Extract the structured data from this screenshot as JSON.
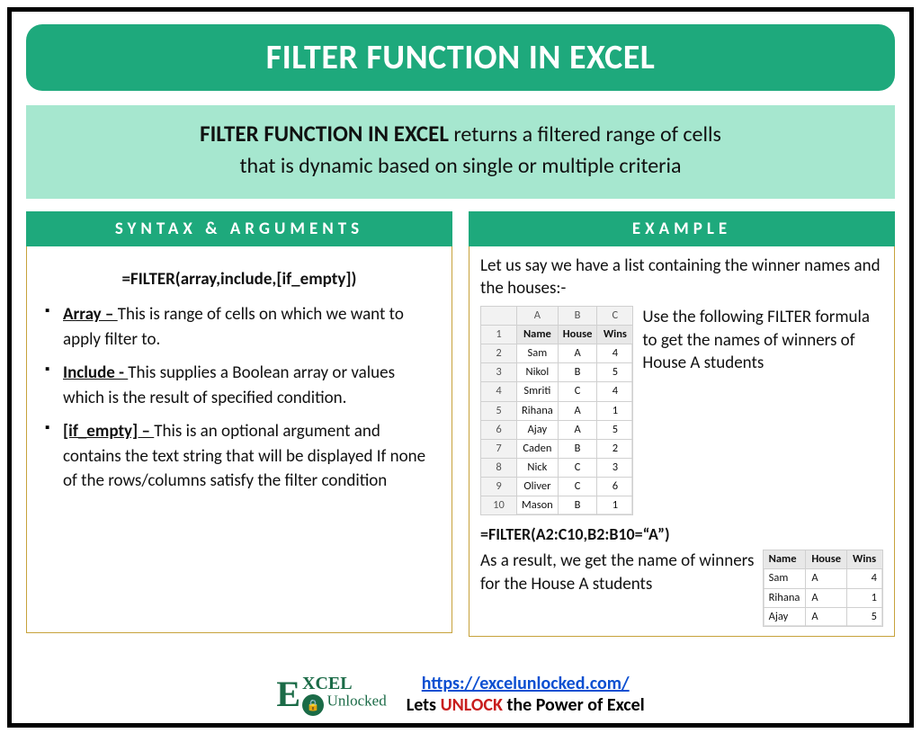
{
  "title": "FILTER FUNCTION IN EXCEL",
  "description": {
    "strong": "FILTER FUNCTION IN EXCEL",
    "rest1": " returns a filtered range of cells",
    "rest2": "that is dynamic based on single or multiple criteria"
  },
  "left": {
    "header": "SYNTAX & ARGUMENTS",
    "formula": "=FILTER(array,include,[if_empty])",
    "args": [
      {
        "name": "Array – ",
        "text": "This is range of cells on which we want to apply filter to."
      },
      {
        "name": "Include -  ",
        "text": "This supplies a Boolean array or values which is the result of specified condition."
      },
      {
        "name": "[if_empty] – ",
        "text": "This is an optional argument and contains the text string that will be displayed If none of the rows/columns satisfy the filter condition"
      }
    ]
  },
  "right": {
    "header": "EXAMPLE",
    "intro": "Let us say we have a list containing the winner names and the houses:-",
    "side_text": "Use the following FILTER formula to get the names of winners of House A students",
    "sheet": {
      "cols": [
        "A",
        "B",
        "C"
      ],
      "headers": [
        "Name",
        "House",
        "Wins"
      ],
      "rows": [
        {
          "n": "2",
          "cells": [
            "Sam",
            "A",
            "4"
          ]
        },
        {
          "n": "3",
          "cells": [
            "Nikol",
            "B",
            "5"
          ]
        },
        {
          "n": "4",
          "cells": [
            "Smriti",
            "C",
            "4"
          ]
        },
        {
          "n": "5",
          "cells": [
            "Rihana",
            "A",
            "1"
          ]
        },
        {
          "n": "6",
          "cells": [
            "Ajay",
            "A",
            "5"
          ]
        },
        {
          "n": "7",
          "cells": [
            "Caden",
            "B",
            "2"
          ]
        },
        {
          "n": "8",
          "cells": [
            "Nick",
            "C",
            "3"
          ]
        },
        {
          "n": "9",
          "cells": [
            "Oliver",
            "C",
            "6"
          ]
        },
        {
          "n": "10",
          "cells": [
            "Mason",
            "B",
            "1"
          ]
        }
      ]
    },
    "formula": "=FILTER(A2:C10,B2:B10=“A”)",
    "result_text": "As a result, we get the name of winners for the House A students",
    "result": {
      "headers": [
        "Name",
        "House",
        "Wins"
      ],
      "rows": [
        [
          "Sam",
          "A",
          "4"
        ],
        [
          "Rihana",
          "A",
          "1"
        ],
        [
          "Ajay",
          "A",
          "5"
        ]
      ]
    }
  },
  "footer": {
    "url": "https://excelunlocked.com/",
    "tagline_pre": "Lets ",
    "tagline_mid": "UNLOCK",
    "tagline_post": " the Power of Excel",
    "logo_top": "XCEL",
    "logo_bottom": "Unlocked"
  }
}
